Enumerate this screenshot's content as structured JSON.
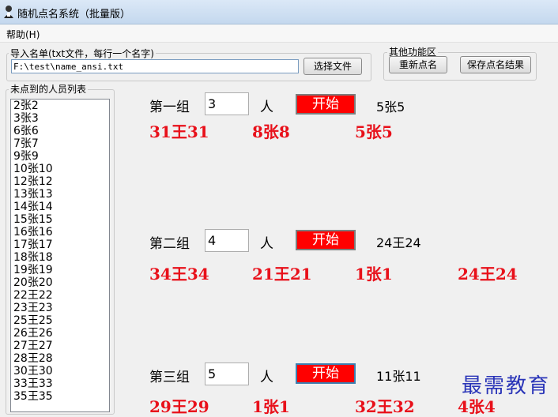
{
  "window": {
    "title": "随机点名系统（批量版）"
  },
  "menu": {
    "help": "帮助(H)"
  },
  "import": {
    "label": "导入名单(txt文件，每行一个名字)",
    "path": "F:\\test\\name_ansi.txt",
    "choose_button": "选择文件"
  },
  "other": {
    "label": "其他功能区",
    "rename_button": "重新点名",
    "save_button": "保存点名结果"
  },
  "absent": {
    "label": "未点到的人员列表",
    "items": [
      "2张2",
      "3张3",
      "6张6",
      "7张7",
      "9张9",
      "10张10",
      "12张12",
      "13张13",
      "14张14",
      "15张15",
      "16张16",
      "17张17",
      "18张18",
      "19张19",
      "20张20",
      "22王22",
      "23王23",
      "25王25",
      "26王26",
      "27王27",
      "28王28",
      "30王30",
      "33王33",
      "35王35"
    ]
  },
  "unit": "人",
  "start_label": "开始",
  "groups": [
    {
      "name": "第一组",
      "count": "3",
      "current": "5张5",
      "picked": [
        "31王31",
        "8张8",
        "5张5"
      ]
    },
    {
      "name": "第二组",
      "count": "4",
      "current": "24王24",
      "picked": [
        "34王34",
        "21王21",
        "1张1",
        "24王24"
      ]
    },
    {
      "name": "第三组",
      "count": "5",
      "current": "11张11",
      "picked": [
        "29王29",
        "1张1",
        "32王32",
        "4张4"
      ]
    }
  ],
  "watermark": "最需教育",
  "colors": {
    "start_button": "#ff0000",
    "picked_text": "#e8101a",
    "watermark": "#2a35b8"
  },
  "icons": {
    "app": "app-icon"
  }
}
